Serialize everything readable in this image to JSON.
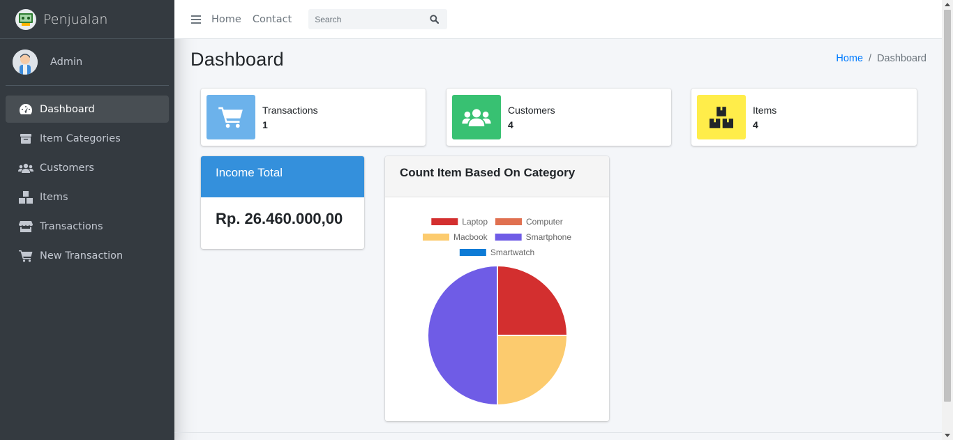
{
  "app": {
    "brand": "Penjualan"
  },
  "user": {
    "name": "Admin"
  },
  "sidebar": {
    "items": [
      {
        "label": "Dashboard",
        "icon": "tachometer-icon",
        "active": true
      },
      {
        "label": "Item Categories",
        "icon": "archive-icon",
        "active": false
      },
      {
        "label": "Customers",
        "icon": "users-icon",
        "active": false
      },
      {
        "label": "Items",
        "icon": "boxes-icon",
        "active": false
      },
      {
        "label": "Transactions",
        "icon": "store-icon",
        "active": false
      },
      {
        "label": "New Transaction",
        "icon": "cart-icon",
        "active": false
      }
    ]
  },
  "navbar": {
    "links": [
      "Home",
      "Contact"
    ],
    "search_placeholder": "Search"
  },
  "page": {
    "title": "Dashboard",
    "breadcrumb": [
      "Home",
      "Dashboard"
    ]
  },
  "info_boxes": [
    {
      "label": "Transactions",
      "value": "1",
      "color": "#6cb2eb",
      "icon": "cart-icon"
    },
    {
      "label": "Customers",
      "value": "4",
      "color": "#38c172",
      "icon": "users-icon"
    },
    {
      "label": "Items",
      "value": "4",
      "color": "#ffed4a",
      "icon": "boxes-icon"
    }
  ],
  "income": {
    "title": "Income Total",
    "value": "Rp. 26.460.000,00",
    "color": "#3490dc"
  },
  "chart_card": {
    "title": "Count Item Based On Category"
  },
  "chart_data": {
    "type": "pie",
    "title": "Count Item Based On Category",
    "categories": [
      "Laptop",
      "Computer",
      "Macbook",
      "Smartphone",
      "Smartwatch"
    ],
    "values": [
      1,
      0,
      1,
      2,
      0
    ],
    "colors": [
      "#d32f2f",
      "#e07050",
      "#fccb6e",
      "#6f5ce6",
      "#0d7bd6"
    ],
    "legend": "top"
  }
}
